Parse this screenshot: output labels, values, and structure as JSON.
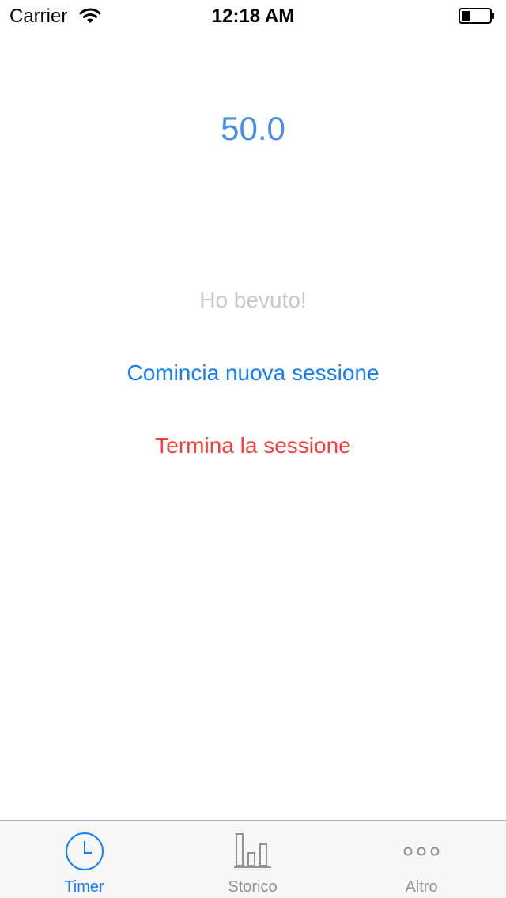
{
  "status_bar": {
    "carrier": "Carrier",
    "time": "12:18 AM",
    "wifi_icon": "wifi-icon",
    "battery_icon": "battery-icon"
  },
  "main": {
    "timer_value": "50.0",
    "drank_label": "Ho bevuto!",
    "start_label": "Comincia nuova sessione",
    "end_label": "Termina la sessione"
  },
  "tab_bar": {
    "items": [
      {
        "label": "Timer",
        "icon": "clock-icon",
        "selected": true
      },
      {
        "label": "Storico",
        "icon": "bar-chart-icon",
        "selected": false
      },
      {
        "label": "Altro",
        "icon": "more-icon",
        "selected": false
      }
    ]
  },
  "colors": {
    "accent": "#157efb",
    "timer_text": "#4a90e2",
    "disabled_text": "#c7c7cc",
    "destructive": "#fc3d39",
    "tab_inactive": "#929292",
    "tab_bar_background": "#f7f7f7"
  }
}
